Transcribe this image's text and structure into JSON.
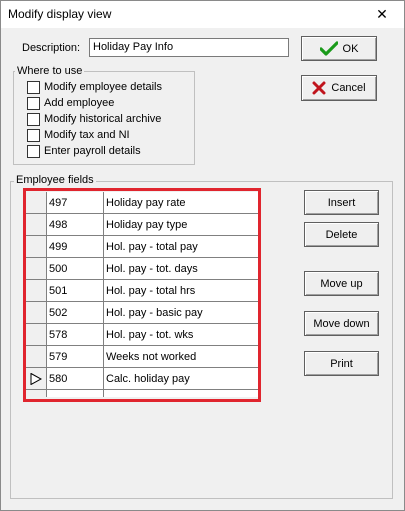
{
  "window": {
    "title": "Modify display view",
    "close_glyph": "✕"
  },
  "description": {
    "label": "Description:",
    "value": "Holiday Pay Info"
  },
  "buttons": {
    "ok": "OK",
    "cancel": "Cancel",
    "insert": "Insert",
    "delete": "Delete",
    "move_up": "Move up",
    "move_down": "Move down",
    "print": "Print"
  },
  "where_to_use": {
    "legend": "Where to use",
    "options": [
      {
        "label": "Modify employee details",
        "checked": false
      },
      {
        "label": "Add employee",
        "checked": false
      },
      {
        "label": "Modify historical archive",
        "checked": false
      },
      {
        "label": "Modify tax and NI",
        "checked": false
      },
      {
        "label": "Enter payroll details",
        "checked": false
      }
    ]
  },
  "employee_fields": {
    "legend": "Employee fields",
    "rows": [
      {
        "code": "497",
        "name": "Holiday pay rate"
      },
      {
        "code": "498",
        "name": "Holiday pay type"
      },
      {
        "code": "499",
        "name": "Hol. pay - total pay"
      },
      {
        "code": "500",
        "name": "Hol. pay - tot. days"
      },
      {
        "code": "501",
        "name": "Hol. pay - total hrs"
      },
      {
        "code": "502",
        "name": "Hol. pay - basic pay"
      },
      {
        "code": "578",
        "name": "Hol. pay - tot. wks"
      },
      {
        "code": "579",
        "name": "Weeks not worked"
      },
      {
        "code": "580",
        "name": "Calc. holiday pay"
      },
      {
        "code": "",
        "name": ""
      }
    ],
    "current_row_index": 8
  },
  "colors": {
    "ok_check": "#1a9a1a",
    "cancel_x": "#c0141c",
    "highlight_frame": "#e0252e"
  }
}
